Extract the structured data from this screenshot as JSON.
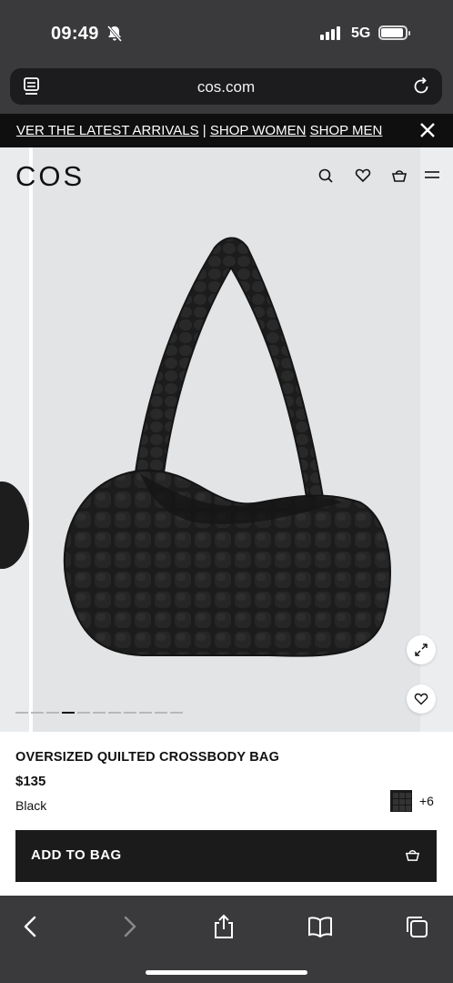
{
  "status_bar": {
    "time": "09:49",
    "network": "5G",
    "mute_icon": "bell-slash-icon"
  },
  "browser": {
    "url": "cos.com"
  },
  "promo": {
    "part1": "VER THE LATEST ARRIVALS",
    "sep": " | ",
    "part2": "SHOP WOMEN",
    "part3": "SHOP MEN"
  },
  "site": {
    "logo": "COS",
    "header_icons": [
      "search-icon",
      "heart-icon",
      "basket-icon",
      "menu-icon"
    ]
  },
  "gallery": {
    "image_count": 11,
    "active_index": 3
  },
  "product": {
    "name": "OVERSIZED QUILTED CROSSBODY BAG",
    "price": "$135",
    "color": "Black",
    "more_colors": "+6",
    "add_to_bag": "ADD TO BAG"
  },
  "colors": {
    "bag": "#1c1c1c",
    "gallery_bg": "#e2e4e6",
    "button_bg": "#1b1b1b",
    "chrome": "#3a3a3c"
  }
}
